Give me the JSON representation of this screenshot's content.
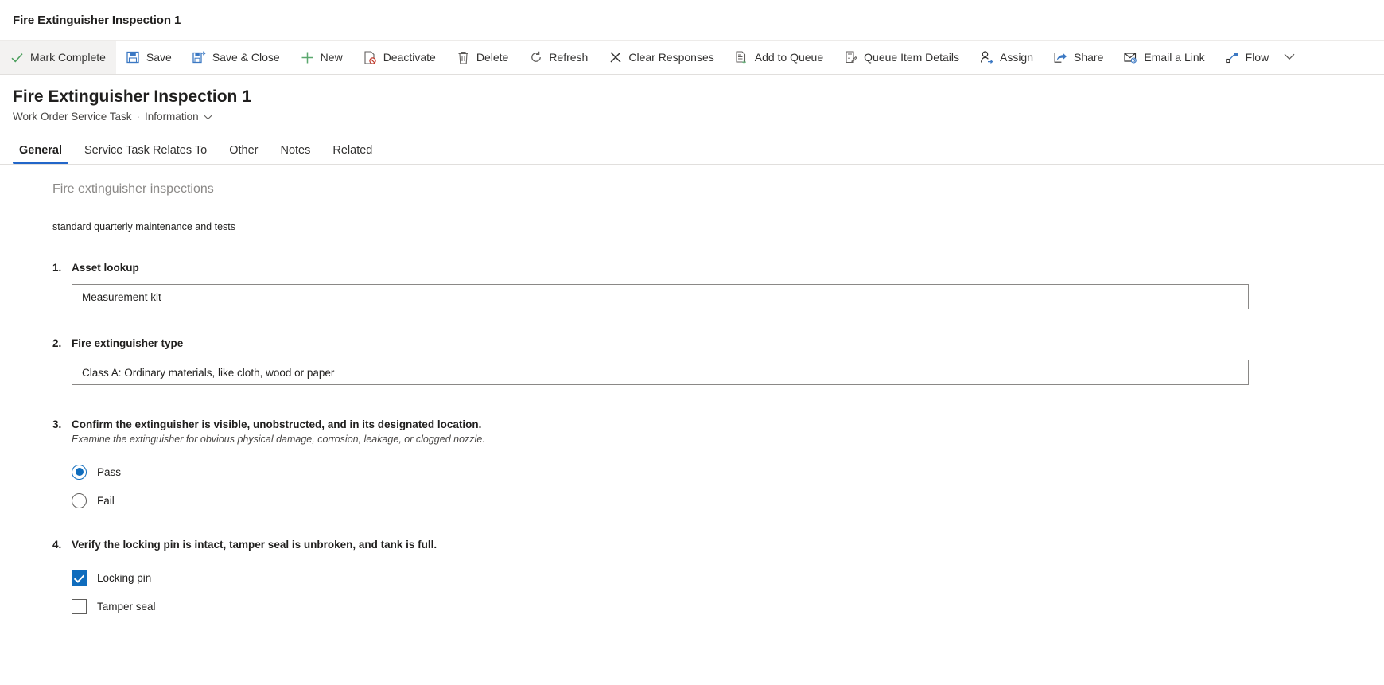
{
  "window": {
    "title": "Fire Extinguisher Inspection 1"
  },
  "commandbar": {
    "items": [
      {
        "label": "Mark Complete",
        "icon": "checkmark-icon",
        "highlighted": true
      },
      {
        "label": "Save",
        "icon": "save-icon"
      },
      {
        "label": "Save & Close",
        "icon": "save-and-close-icon"
      },
      {
        "label": "New",
        "icon": "plus-icon"
      },
      {
        "label": "Deactivate",
        "icon": "deactivate-icon"
      },
      {
        "label": "Delete",
        "icon": "trash-icon"
      },
      {
        "label": "Refresh",
        "icon": "refresh-icon"
      },
      {
        "label": "Clear Responses",
        "icon": "close-x-icon"
      },
      {
        "label": "Add to Queue",
        "icon": "add-to-queue-icon"
      },
      {
        "label": "Queue Item Details",
        "icon": "queue-item-details-icon"
      },
      {
        "label": "Assign",
        "icon": "assign-person-icon"
      },
      {
        "label": "Share",
        "icon": "share-icon"
      },
      {
        "label": "Email a Link",
        "icon": "email-link-icon"
      },
      {
        "label": "Flow",
        "icon": "flow-icon"
      }
    ],
    "overflow_icon": "chevron-down-icon"
  },
  "record": {
    "title": "Fire Extinguisher Inspection 1",
    "entity": "Work Order Service Task",
    "separator": "·",
    "form_name": "Information",
    "form_caret_icon": "chevron-down-icon"
  },
  "tabs": [
    {
      "label": "General",
      "active": true
    },
    {
      "label": "Service Task Relates To",
      "active": false
    },
    {
      "label": "Other",
      "active": false
    },
    {
      "label": "Notes",
      "active": false
    },
    {
      "label": "Related",
      "active": false
    }
  ],
  "form": {
    "section_title": "Fire extinguisher inspections",
    "section_description": "standard quarterly maintenance and tests",
    "questions": [
      {
        "number": "1.",
        "label": "Asset lookup",
        "hint": "",
        "type": "text",
        "value": "Measurement kit",
        "placeholder": ""
      },
      {
        "number": "2.",
        "label": "Fire extinguisher type",
        "hint": "",
        "type": "text",
        "value": "Class A: Ordinary materials, like cloth, wood or paper",
        "placeholder": ""
      },
      {
        "number": "3.",
        "label": "Confirm the extinguisher is visible, unobstructed, and in its designated location.",
        "hint": "Examine the extinguisher for obvious physical damage, corrosion, leakage, or clogged nozzle.",
        "type": "radio",
        "options": [
          {
            "label": "Pass",
            "selected": true
          },
          {
            "label": "Fail",
            "selected": false
          }
        ]
      },
      {
        "number": "4.",
        "label": "Verify the locking pin is intact, tamper seal is unbroken, and tank is full.",
        "hint": "",
        "type": "checkbox",
        "options": [
          {
            "label": "Locking pin",
            "selected": true
          },
          {
            "label": "Tamper seal",
            "selected": false
          }
        ]
      }
    ]
  },
  "colors": {
    "accent": "#0f6cbd",
    "tab_underline": "#2266c9",
    "checkmark_green": "#4a9e5c",
    "command_icon_blue": "#3b78c3",
    "text_primary": "#201f1e",
    "text_secondary": "#484644",
    "text_muted": "#8a8886",
    "border": "#e1dfdd",
    "highlight_bg": "#f3f2f1"
  }
}
